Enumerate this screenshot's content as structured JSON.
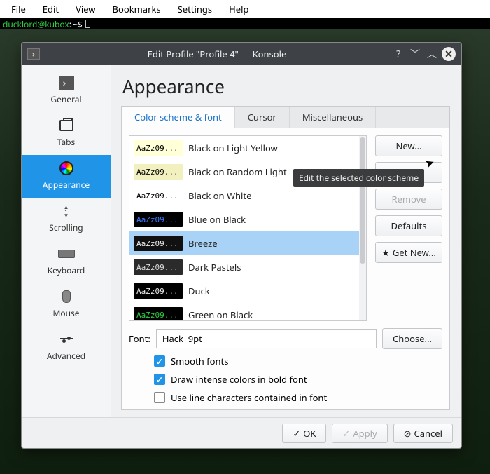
{
  "menubar": [
    "File",
    "Edit",
    "View",
    "Bookmarks",
    "Settings",
    "Help"
  ],
  "terminal": {
    "prompt": "ducklord@kubox",
    "path": "~$"
  },
  "dialog": {
    "title": "Edit Profile \"Profile 4\" — Konsole",
    "heading": "Appearance"
  },
  "sidebar": {
    "items": [
      {
        "label": "General"
      },
      {
        "label": "Tabs"
      },
      {
        "label": "Appearance"
      },
      {
        "label": "Scrolling"
      },
      {
        "label": "Keyboard"
      },
      {
        "label": "Mouse"
      },
      {
        "label": "Advanced"
      }
    ],
    "active": 2
  },
  "tabs": [
    "Color scheme & font",
    "Cursor",
    "Miscellaneous"
  ],
  "schemes": [
    {
      "label": "Black on Light Yellow",
      "fg": "#000",
      "bg": "#ffffd8"
    },
    {
      "label": "Black on Random Light",
      "fg": "#000",
      "bg": "#f3f0c0"
    },
    {
      "label": "Black on White",
      "fg": "#000",
      "bg": "#fff"
    },
    {
      "label": "Blue on Black",
      "fg": "#3a7bff",
      "bg": "#000"
    },
    {
      "label": "Breeze",
      "fg": "#eee",
      "bg": "#111",
      "selected": true
    },
    {
      "label": "Dark Pastels",
      "fg": "#ddd",
      "bg": "#2b2b2b"
    },
    {
      "label": "Duck",
      "fg": "#eee",
      "bg": "#000"
    },
    {
      "label": "Green on Black",
      "fg": "#2ecc40",
      "bg": "#000"
    }
  ],
  "sample_text": "AaZz09...",
  "buttons": {
    "new": "New...",
    "edit": "Edit...",
    "remove": "Remove",
    "defaults": "Defaults",
    "getnew": "Get New...",
    "choose": "Choose...",
    "ok": "OK",
    "apply": "Apply",
    "cancel": "Cancel"
  },
  "tooltip": "Edit the selected color scheme",
  "font": {
    "label": "Font:",
    "value": "Hack  9pt"
  },
  "checks": {
    "smooth": "Smooth fonts",
    "bold": "Draw intense colors in bold font",
    "linechars": "Use line characters contained in font"
  }
}
